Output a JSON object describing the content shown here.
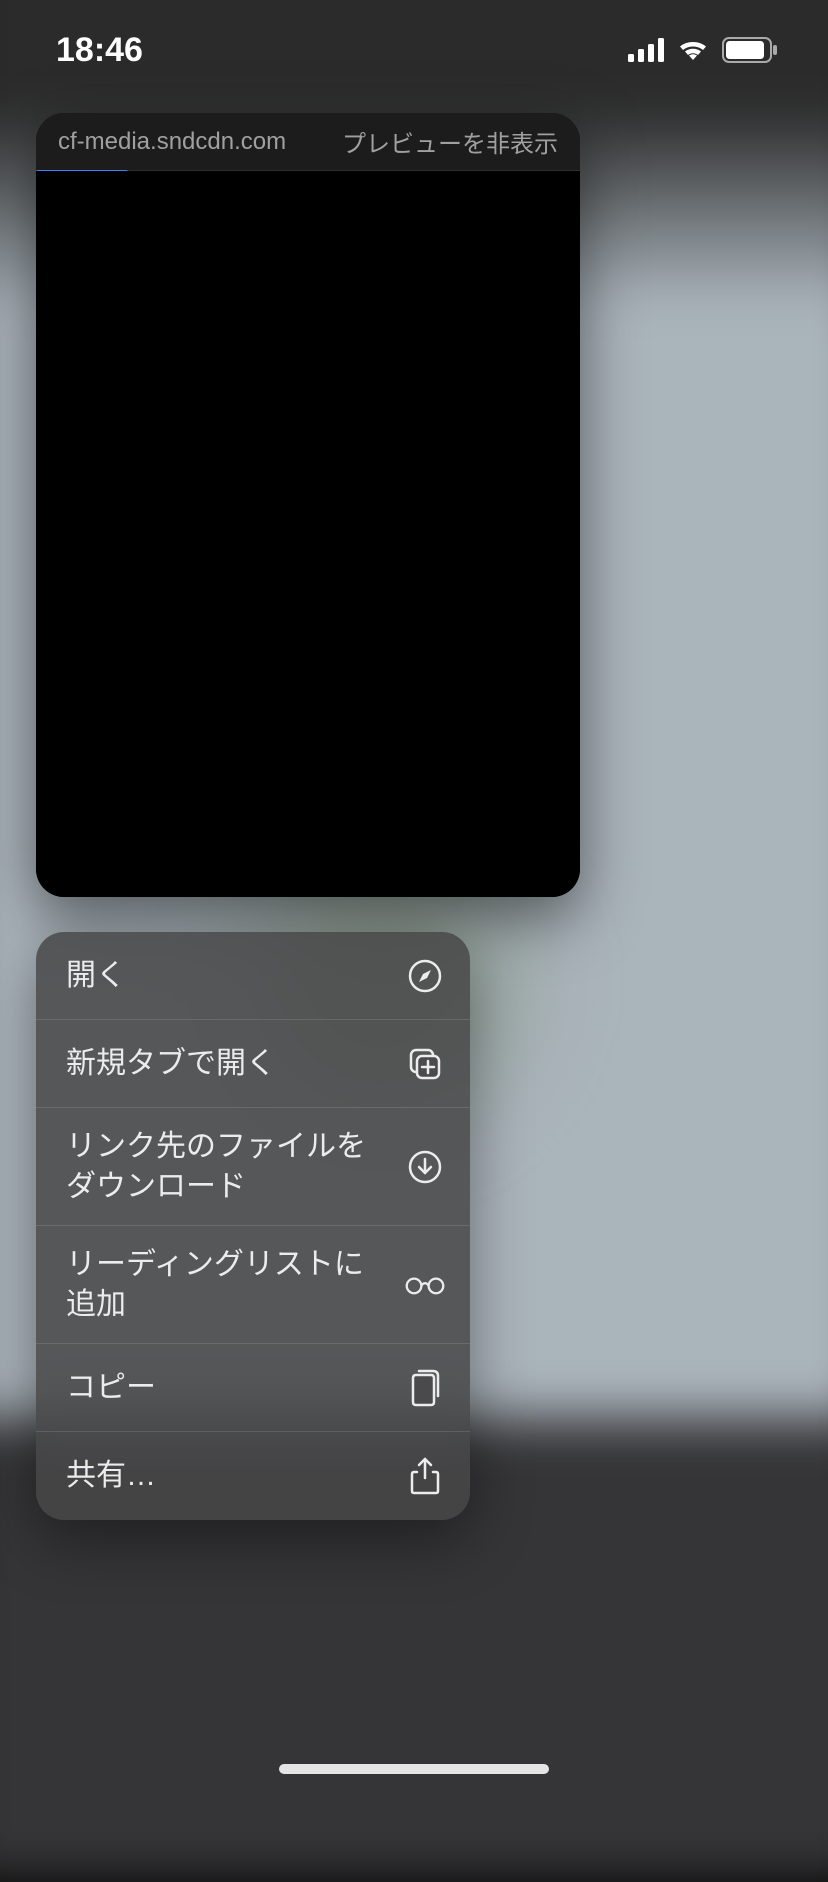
{
  "status": {
    "time": "18:46"
  },
  "preview": {
    "url": "cf-media.sndcdn.com",
    "hide_preview_label": "プレビューを非表示"
  },
  "menu": {
    "items": [
      {
        "label": "開く",
        "icon": "compass-icon",
        "multiline": false
      },
      {
        "label": "新規タブで開く",
        "icon": "tabs-plus-icon",
        "multiline": false
      },
      {
        "label": "リンク先のファイルをダウンロード",
        "icon": "download-icon",
        "multiline": true
      },
      {
        "label": "リーディングリストに追加",
        "icon": "glasses-icon",
        "multiline": true
      },
      {
        "label": "コピー",
        "icon": "copy-docs-icon",
        "multiline": false
      },
      {
        "label": "共有…",
        "icon": "share-icon",
        "multiline": false
      }
    ]
  }
}
